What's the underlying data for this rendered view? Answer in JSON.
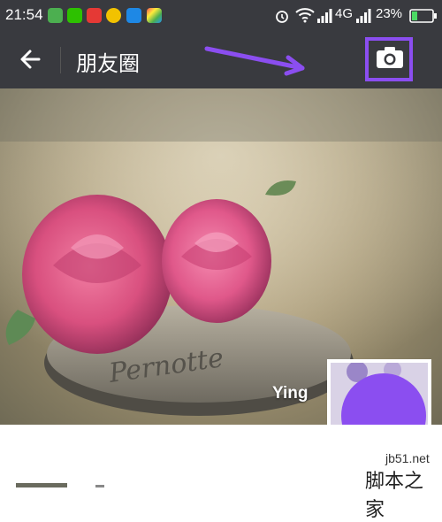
{
  "status_bar": {
    "time": "21:54",
    "network": "4G",
    "battery": "23%",
    "app_icons": [
      "msg-icon",
      "wechat-icon",
      "weibo-icon",
      "plus-icon",
      "clean-icon",
      "colorful-icon"
    ]
  },
  "header": {
    "title": "朋友圈"
  },
  "cover": {
    "coin_text": "Pernotte",
    "username": "Ying"
  },
  "watermark": {
    "url": "jb51.net",
    "text": "脚本之家"
  },
  "colors": {
    "bar": "#393a3f",
    "highlight": "#8b4ef0",
    "avatar_mask": "#8b4ef0"
  }
}
